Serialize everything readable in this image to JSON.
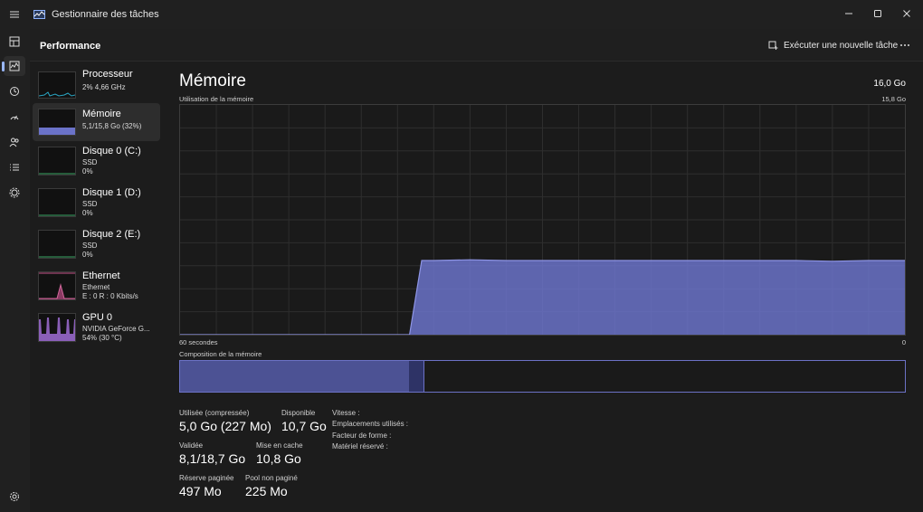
{
  "window": {
    "title": "Gestionnaire des tâches"
  },
  "header": {
    "section": "Performance",
    "run_task": "Exécuter une nouvelle tâche"
  },
  "nav": {
    "icons": [
      "hamburger-menu-icon",
      "processes-icon",
      "performance-icon",
      "app-history-icon",
      "startup-apps-icon",
      "users-icon",
      "details-icon",
      "services-icon",
      "settings-icon"
    ],
    "active": "performance-icon"
  },
  "sidebar": {
    "items": [
      {
        "name": "Processeur",
        "line1": "2% 4,66 GHz",
        "line2": ""
      },
      {
        "name": "Mémoire",
        "line1": "5,1/15,8 Go (32%)",
        "line2": ""
      },
      {
        "name": "Disque 0 (C:)",
        "line1": "SSD",
        "line2": "0%"
      },
      {
        "name": "Disque 1 (D:)",
        "line1": "SSD",
        "line2": "0%"
      },
      {
        "name": "Disque 2 (E:)",
        "line1": "SSD",
        "line2": "0%"
      },
      {
        "name": "Ethernet",
        "line1": "Ethernet",
        "line2": "E : 0 R : 0 Kbits/s"
      },
      {
        "name": "GPU 0",
        "line1": "NVIDIA GeForce G...",
        "line2": "54% (30 °C)"
      }
    ],
    "selected_index": 1
  },
  "memory": {
    "title": "Mémoire",
    "total": "16,0 Go",
    "usage_label": "Utilisation de la mémoire",
    "usage_max": "15,8 Go",
    "axis_left": "60 secondes",
    "axis_right": "0",
    "composition_label": "Composition de la mémoire",
    "graph_color": "#6b73c9",
    "composition": {
      "in_use_gb": 5.0,
      "modified_gb": 0.3,
      "standby_gb": 10.5,
      "total_gb": 15.8
    }
  },
  "stats": {
    "used_label": "Utilisée (compressée)",
    "used_value": "5,0 Go (227 Mo)",
    "available_label": "Disponible",
    "available_value": "10,7 Go",
    "committed_label": "Validée",
    "committed_value": "8,1/18,7 Go",
    "cached_label": "Mise en cache",
    "cached_value": "10,8 Go",
    "paged_label": "Réserve paginée",
    "paged_value": "497 Mo",
    "nonpaged_label": "Pool non paginé",
    "nonpaged_value": "225 Mo",
    "speed_label": "Vitesse :",
    "slots_label": "Emplacements utilisés :",
    "form_label": "Facteur de forme :",
    "reserved_label": "Matériel réservé :"
  },
  "chart_data": {
    "type": "area",
    "title": "Utilisation de la mémoire",
    "xlabel": "",
    "ylabel": "",
    "x_range_seconds": [
      60,
      0
    ],
    "ylim": [
      0,
      15.8
    ],
    "unit": "Go",
    "x": [
      60,
      57,
      54,
      51,
      48,
      45,
      42,
      41,
      40,
      39,
      36,
      33,
      30,
      27,
      24,
      21,
      18,
      15,
      12,
      9,
      6,
      3,
      0
    ],
    "values": [
      0,
      0,
      0,
      0,
      0,
      0,
      0,
      0,
      5.1,
      5.1,
      5.15,
      5.1,
      5.1,
      5.1,
      5.1,
      5.1,
      5.1,
      5.1,
      5.1,
      5.1,
      5.05,
      5.1,
      5.1
    ],
    "grid": true
  }
}
